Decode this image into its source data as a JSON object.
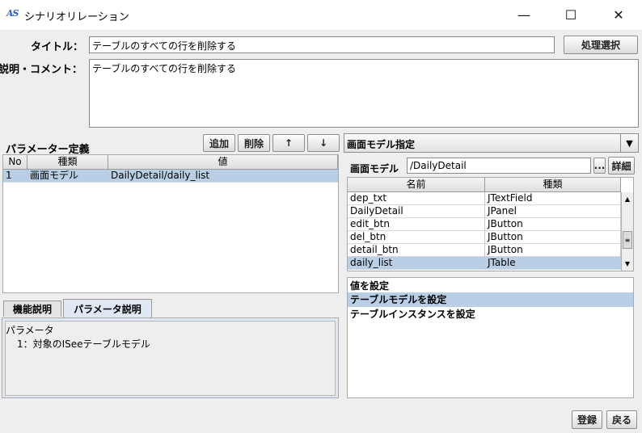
{
  "window": {
    "title": "シナリオリレーション",
    "logo": "AS",
    "minimize": "—",
    "maximize": "☐",
    "close": "✕"
  },
  "header": {
    "title_label": "タイトル：",
    "title_value": "テーブルのすべての行を削除する",
    "process_select_button": "処理選択",
    "comment_label": "説明・コメント：",
    "comment_value": "テーブルのすべての行を削除する"
  },
  "params": {
    "label": "パラメーター定義",
    "add_button": "追加",
    "delete_button": "削除",
    "up_button": "↑",
    "down_button": "↓",
    "columns": [
      "No",
      "種類",
      "値"
    ],
    "rows": [
      {
        "no": "1",
        "type": "画面モデル",
        "value": "DailyDetail/daily_list"
      }
    ]
  },
  "tabs": {
    "function_tab": "機能説明",
    "param_tab": "パラメータ説明",
    "description_line1": "パラメータ",
    "description_line2": "1：対象のISeeテーブルモデル"
  },
  "screen_model": {
    "dropdown_value": "画面モデル指定",
    "label": "画面モデル",
    "path_value": "/DailyDetail",
    "browse_button": "...",
    "detail_button": "詳細",
    "columns": [
      "名前",
      "種類"
    ],
    "rows": [
      {
        "name": "dep_txt",
        "type": "JTextField"
      },
      {
        "name": "DailyDetail",
        "type": "JPanel"
      },
      {
        "name": "edit_btn",
        "type": "JButton"
      },
      {
        "name": "del_btn",
        "type": "JButton"
      },
      {
        "name": "detail_btn",
        "type": "JButton"
      },
      {
        "name": "daily_list",
        "type": "JTable"
      }
    ]
  },
  "set_values": {
    "header": "値を設定",
    "items": [
      "テーブルモデルを設定",
      "テーブルインスタンスを設定"
    ]
  },
  "footer": {
    "register_button": "登録",
    "back_button": "戻る"
  },
  "colors": {
    "selection": "#b8cfe5",
    "background": "#eeeeee"
  }
}
